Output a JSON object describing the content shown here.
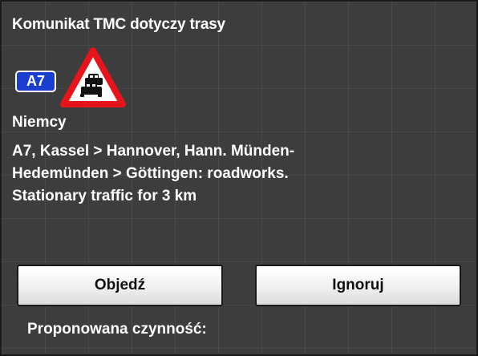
{
  "dialog": {
    "title": "Komunikat TMC dotyczy trasy",
    "road": "A7",
    "icon": "traffic-jam-warning-icon",
    "country": "Niemcy",
    "message_lines": [
      "A7, Kassel > Hannover, Hann. Münden-",
      "Hedemünden > Göttingen:  roadworks.",
      "Stationary traffic for 3 km"
    ]
  },
  "buttons": {
    "detour_label": "Objedź",
    "ignore_label": "Ignoruj"
  },
  "footer": {
    "suggested_action_label": "Proponowana czynność:"
  },
  "colors": {
    "panel_background": "#3d3d3d",
    "road_badge": "#1a3fcf",
    "warning_border": "#e8141c",
    "button_text": "#111111"
  }
}
